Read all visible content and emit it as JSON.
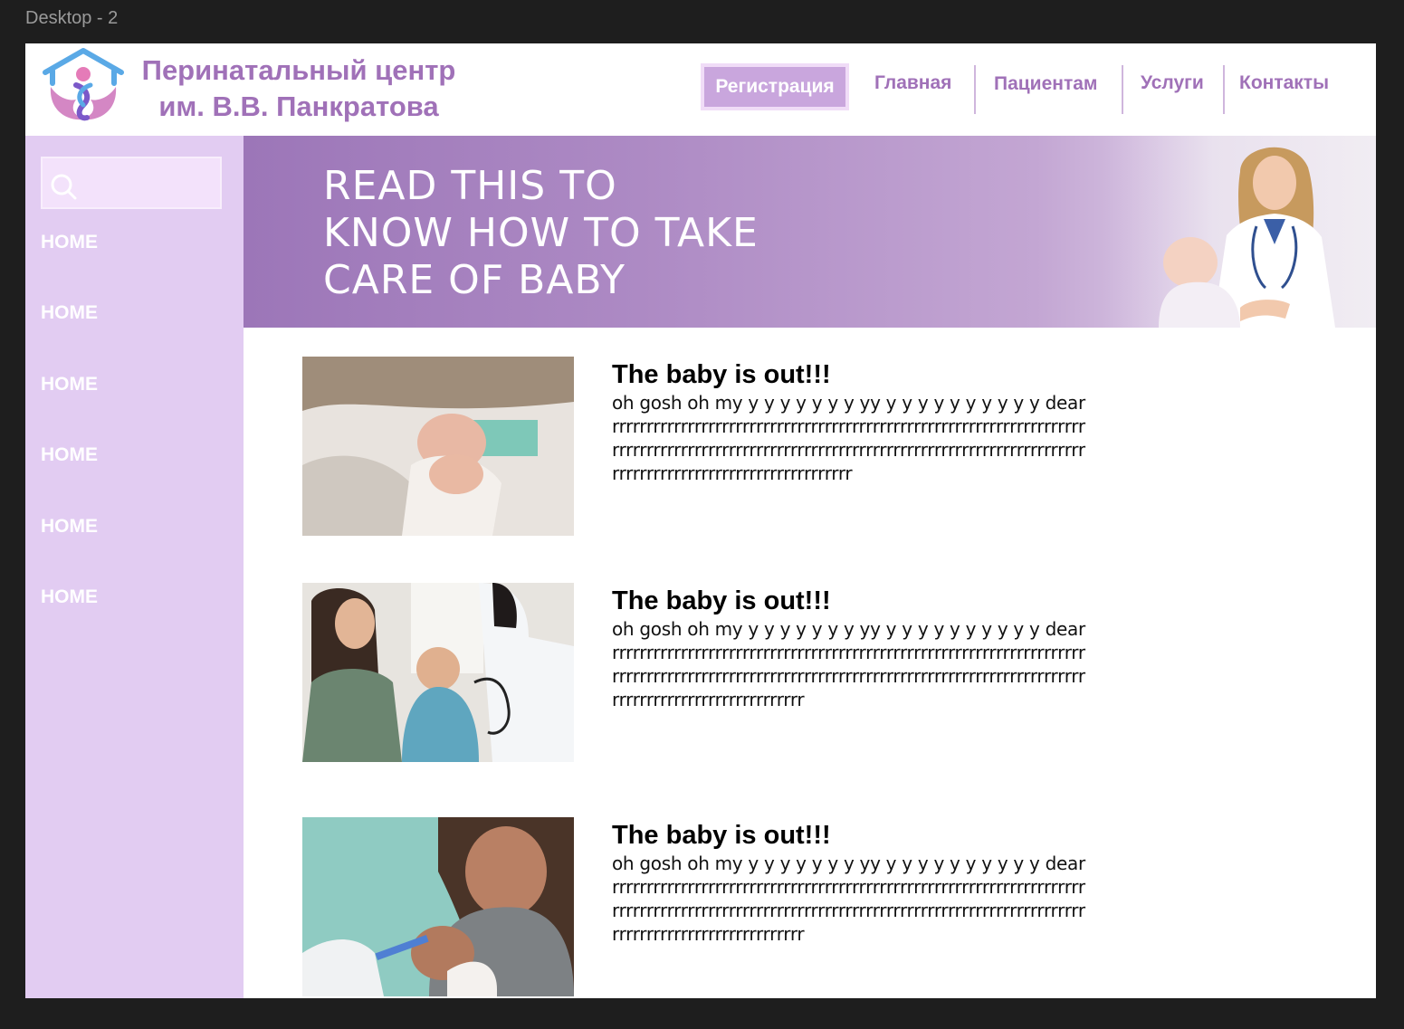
{
  "frame": {
    "label": "Desktop - 2"
  },
  "header": {
    "brand_line1": "Перинатальный центр",
    "brand_line2": "им. В.В. Панкратова",
    "register_label": "Регистрация",
    "nav": [
      "Главная",
      "Пациентам",
      "Услуги",
      "Контакты"
    ]
  },
  "sidebar": {
    "search_icon": "search-icon",
    "items": [
      "HOME",
      "HOME",
      "HOME",
      "HOME",
      "HOME",
      "HOME"
    ]
  },
  "hero": {
    "line1": "READ THIS TO",
    "line2": "KNOW HOW TO TAKE",
    "line3": "CARE OF BABY",
    "image": "doctor-with-baby-photo"
  },
  "articles": [
    {
      "title": "The baby is out!!!",
      "body": "oh gosh oh my y y  y y y y y yy y y y y y y y y y y dearrrrrrrrrrrrrrrrrrrrrrrrrrrrrrrrrrrrrrrrrrrrrrrrrrrrrrrrrrrrrrrrrrrrrrrrrrrrrrrrrrrrrrrrrrrrrrrrrrrrrrrrrrrrrrrrrrrrrrrrrrrrrrrrrrrrrrrrrrrrrrrrrrrrrrrrrrrrrrrrrrrrrrrrrrrrrr",
      "image": "sleeping-newborn-photo"
    },
    {
      "title": "The baby is out!!!",
      "body": "oh gosh oh my y y  y y y y y yy y y y y y y y y y y dearrrrrrrrrrrrrrrrrrrrrrrrrrrrrrrrrrrrrrrrrrrrrrrrrrrrrrrrrrrrrrrrrrrrrrrrrrrrrrrrrrrrrrrrrrrrrrrrrrrrrrrrrrrrrrrrrrrrrrrrrrrrrrrrrrrrrrrrrrrrrrrrrrrrrrrrrrrrrrrrrrrrrrr",
      "image": "mother-baby-doctor-photo"
    },
    {
      "title": "The baby is out!!!",
      "body": "oh gosh oh my y y  y y y y y yy y y y y y y y y y y dearrrrrrrrrrrrrrrrrrrrrrrrrrrrrrrrrrrrrrrrrrrrrrrrrrrrrrrrrrrrrrrrrrrrrrrrrrrrrrrrrrrrrrrrrrrrrrrrrrrrrrrrrrrrrrrrrrrrrrrrrrrrrrrrrrrrrrrrrrrrrrrrrrrrrrrrrrrrrrrrrrrrrrr",
      "image": "baby-vaccination-photo"
    }
  ],
  "colors": {
    "brand": "#a071b8",
    "sidebar": "#e2ccf2",
    "register_bg": "#c9a6dd",
    "hero_start": "#9c76b8",
    "hero_end": "#ece3f1"
  }
}
